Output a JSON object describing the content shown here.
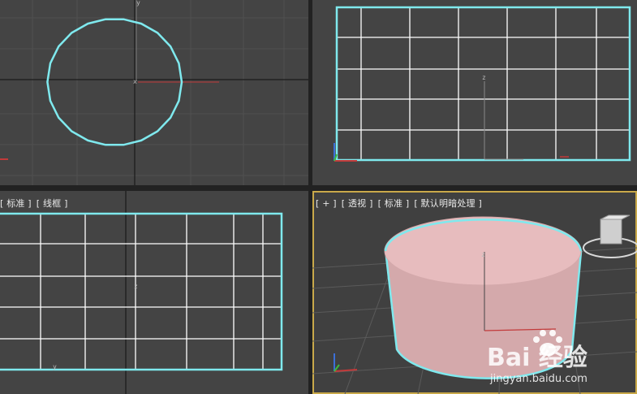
{
  "viewports": {
    "left": {
      "labels": [
        "[ 标准 ]",
        "[ 线框 ]"
      ]
    },
    "perspective": {
      "labels": [
        "[ + ]",
        "[ 透视 ]",
        "[ 标准 ]",
        "[ 默认明暗处理 ]"
      ]
    }
  },
  "axes": {
    "x": "x",
    "y": "y",
    "z": "z"
  },
  "watermark": {
    "logo": "Bai  经验",
    "url": "jingyan.baidu.com"
  },
  "colors": {
    "viewport_bg": "#444444",
    "selection": "#7fe9ee",
    "grid_white": "#ffffff",
    "cylinder_fill": "#d8b1b3",
    "active_border": "#c9a94a"
  },
  "icons": [
    "view-cube-icon",
    "paw-icon"
  ]
}
